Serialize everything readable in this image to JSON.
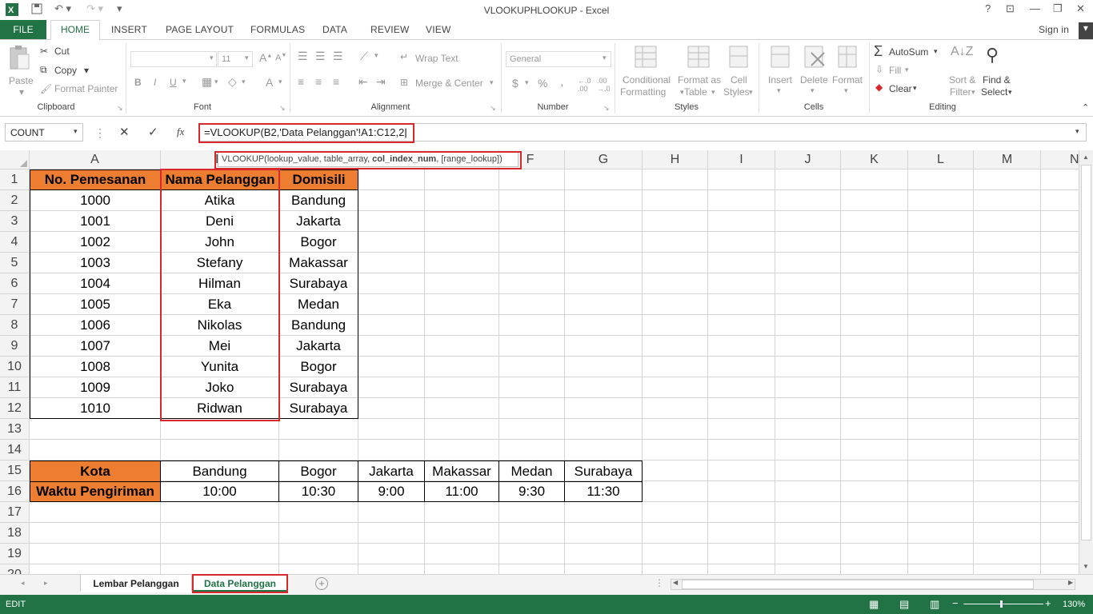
{
  "window": {
    "title": "VLOOKUPHLOOKUP - Excel",
    "help": "?",
    "signin": "Sign in"
  },
  "ribbon_tabs": [
    "FILE",
    "HOME",
    "INSERT",
    "PAGE LAYOUT",
    "FORMULAS",
    "DATA",
    "REVIEW",
    "VIEW"
  ],
  "clipboard": {
    "paste": "Paste",
    "cut": "Cut",
    "copy": "Copy",
    "format_painter": "Format Painter",
    "label": "Clipboard"
  },
  "font": {
    "name": "",
    "size": "11",
    "label": "Font",
    "bold": "B",
    "italic": "I",
    "underline": "U",
    "font_color": "A"
  },
  "alignment": {
    "wrap": "Wrap Text",
    "merge": "Merge & Center",
    "label": "Alignment"
  },
  "number": {
    "format": "General",
    "label": "Number",
    "currency": "$",
    "percent": "%",
    "comma": ","
  },
  "styles": {
    "conditional": "Conditional",
    "conditional2": "Formatting",
    "format_as": "Format as",
    "format_as2": "Table",
    "cell": "Cell",
    "cell2": "Styles",
    "label": "Styles"
  },
  "cells": {
    "insert": "Insert",
    "delete": "Delete",
    "format": "Format",
    "label": "Cells"
  },
  "editing": {
    "autosum": "AutoSum",
    "fill": "Fill",
    "clear": "Clear",
    "sort": "Sort &",
    "sort2": "Filter",
    "find": "Find &",
    "find2": "Select",
    "label": "Editing"
  },
  "formula_bar": {
    "name_box": "COUNT",
    "formula": "=VLOOKUP(B2,'Data Pelanggan'!A1:C12,2",
    "fx": "fx"
  },
  "tooltip": {
    "prefix": "VLOOKUP(lookup_value, table_array, ",
    "bold": "col_index_num",
    "suffix": ", [range_lookup])"
  },
  "columns": [
    "A",
    "B",
    "C",
    "D",
    "E",
    "F",
    "G",
    "H",
    "I",
    "J",
    "K",
    "L",
    "M",
    "N"
  ],
  "rows": [
    "1",
    "2",
    "3",
    "4",
    "5",
    "6",
    "7",
    "8",
    "9",
    "10",
    "11",
    "12",
    "13",
    "14",
    "15",
    "16",
    "17",
    "18",
    "19",
    "20"
  ],
  "table": {
    "headers": [
      "No. Pemesanan",
      "Nama Pelanggan",
      "Domisili"
    ],
    "data": [
      [
        "1000",
        "Atika",
        "Bandung"
      ],
      [
        "1001",
        "Deni",
        "Jakarta"
      ],
      [
        "1002",
        "John",
        "Bogor"
      ],
      [
        "1003",
        "Stefany",
        "Makassar"
      ],
      [
        "1004",
        "Hilman",
        "Surabaya"
      ],
      [
        "1005",
        "Eka",
        "Medan"
      ],
      [
        "1006",
        "Nikolas",
        "Bandung"
      ],
      [
        "1007",
        "Mei",
        "Jakarta"
      ],
      [
        "1008",
        "Yunita",
        "Bogor"
      ],
      [
        "1009",
        "Joko",
        "Surabaya"
      ],
      [
        "1010",
        "Ridwan",
        "Surabaya"
      ]
    ]
  },
  "lookup": {
    "kota_label": "Kota",
    "waktu_label": "Waktu Pengiriman",
    "cities": [
      "Bandung",
      "Bogor",
      "Jakarta",
      "Makassar",
      "Medan",
      "Surabaya"
    ],
    "times": [
      "10:00",
      "10:30",
      "9:00",
      "11:00",
      "9:30",
      "11:30"
    ]
  },
  "sheets": [
    "Lembar Pelanggan",
    "Data Pelanggan"
  ],
  "status": {
    "mode": "EDIT",
    "zoom": "130%"
  },
  "colors": {
    "accent": "#217346",
    "header_fill": "#ed7d31",
    "highlight": "#d9272e"
  }
}
